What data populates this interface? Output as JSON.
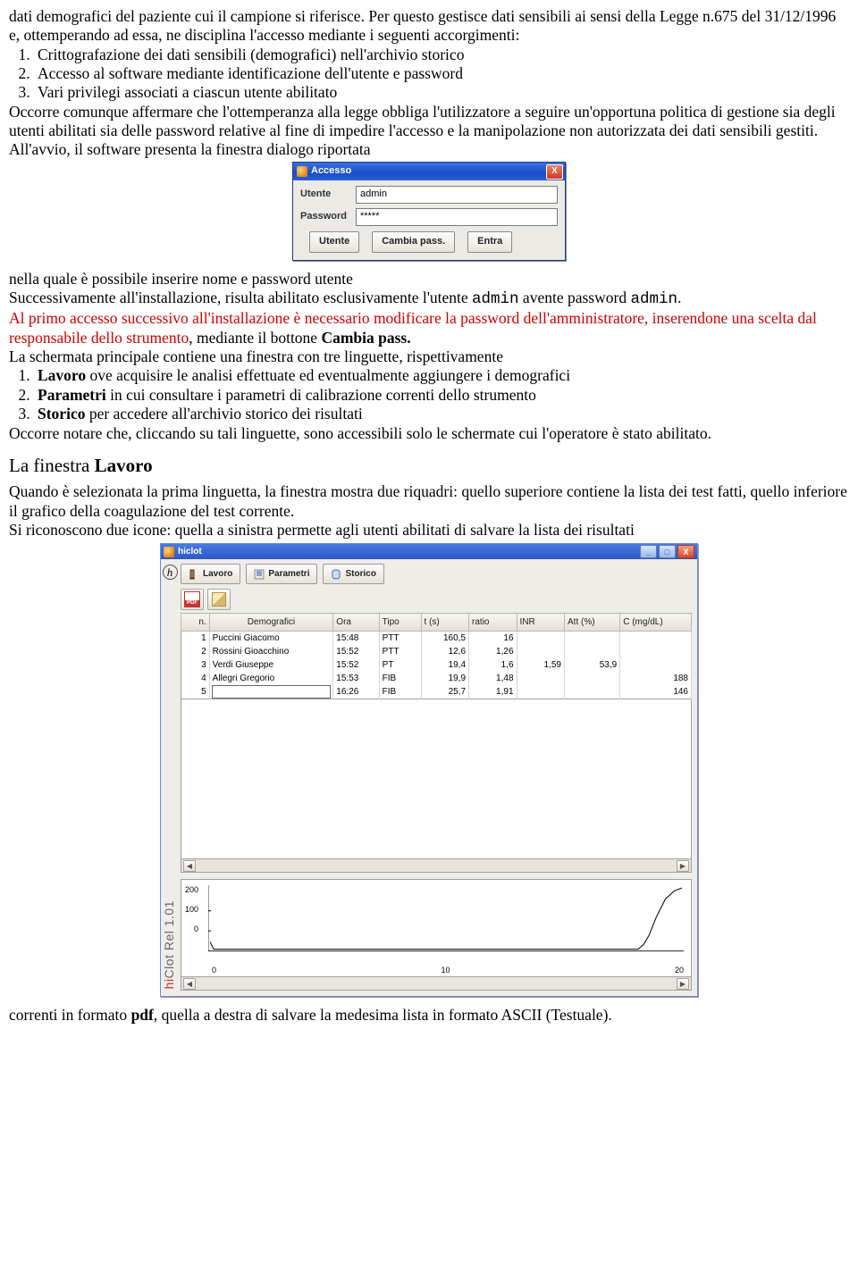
{
  "para1a": "dati demografici del paziente cui il campione si riferisce. Per questo gestisce dati sensibili ai sensi della Legge n.675 del 31/12/1996 e, ottemperando ad essa, ne disciplina l'accesso mediante i seguenti accorgimenti:",
  "list1": {
    "i1": "Crittografazione dei dati sensibili (demografici) nell'archivio storico",
    "i2": "Accesso al software mediante identificazione dell'utente e password",
    "i3": "Vari privilegi associati a ciascun utente abilitato"
  },
  "para1b": "Occorre comunque affermare che l'ottemperanza alla legge obbliga l'utilizzatore a seguire un'opportuna politica di gestione sia degli utenti abilitati sia delle password relative al fine di impedire l'accesso e la manipolazione non autorizzata dei dati sensibili gestiti.",
  "para1c": "All'avvio, il software presenta la finestra dialogo riportata",
  "accesso": {
    "title": "Accesso",
    "lblUser": "Utente",
    "lblPass": "Password",
    "valUser": "admin",
    "valPass": "*****",
    "btnUser": "Utente",
    "btnChange": "Cambia pass.",
    "btnEnter": "Entra"
  },
  "para2a": "nella quale è possibile inserire nome e password utente",
  "para2b_pre": "Successivamente all'installazione, risulta abilitato esclusivamente l'utente ",
  "para2b_code1": "admin",
  "para2b_mid": " avente password ",
  "para2b_code2": "admin",
  "para2b_post": ".",
  "para3_red": "Al primo accesso successivo all'installazione è necessario modificare la password dell'amministratore, inserendone una scelta dal responsabile dello strumento",
  "para3_tail1": ", mediante il bottone ",
  "para3_bold": "Cambia pass.",
  "para4": "La schermata principale contiene una finestra con tre linguette, rispettivamente",
  "list2": {
    "i1b": "Lavoro",
    "i1t": " ove acquisire le analisi effettuate ed eventualmente aggiungere i demografici",
    "i2b": "Parametri",
    "i2t": " in cui consultare i parametri di calibrazione correnti dello strumento",
    "i3b": "Storico",
    "i3t": " per accedere all'archivio storico dei risultati"
  },
  "para5": "Occorre notare che, cliccando su tali linguette, sono accessibili solo le schermate cui l'operatore è stato abilitato.",
  "section_h_pre": "La finestra ",
  "section_h_b": "Lavoro",
  "para6": "Quando è selezionata la prima linguetta, la finestra mostra due riquadri: quello superiore contiene la lista dei test fatti, quello inferiore il grafico della coagulazione del test corrente.",
  "para7": "Si riconoscono due icone: quella a sinistra permette agli utenti abilitati di salvare la lista dei risultati",
  "app": {
    "title": "hiclot",
    "vlabel_hi": "hi",
    "vlabel_rest": "Clot Rel 1.01",
    "tabs": {
      "t1": "Lavoro",
      "t2": "Parametri",
      "t3": "Storico"
    },
    "headers": {
      "n": "n.",
      "demo": "Demografici",
      "ora": "Ora",
      "tipo": "Tipo",
      "t": "t (s)",
      "ratio": "ratio",
      "inr": "INR",
      "att": "Att (%)",
      "c": "C (mg/dL)"
    },
    "rows": [
      {
        "n": "1",
        "demo": "Puccini Giacomo",
        "ora": "15:48",
        "tipo": "PTT",
        "t": "160,5",
        "ratio": "16",
        "inr": "",
        "att": "",
        "c": ""
      },
      {
        "n": "2",
        "demo": "Rossini Gioacchino",
        "ora": "15:52",
        "tipo": "PTT",
        "t": "12,6",
        "ratio": "1,26",
        "inr": "",
        "att": "",
        "c": ""
      },
      {
        "n": "3",
        "demo": "Verdi Giuseppe",
        "ora": "15:52",
        "tipo": "PT",
        "t": "19,4",
        "ratio": "1,6",
        "inr": "1,59",
        "att": "53,9",
        "c": ""
      },
      {
        "n": "4",
        "demo": "Allegri Gregorio",
        "ora": "15:53",
        "tipo": "FIB",
        "t": "19,9",
        "ratio": "1,48",
        "inr": "",
        "att": "",
        "c": "188"
      },
      {
        "n": "5",
        "demo": "",
        "ora": "16:26",
        "tipo": "FIB",
        "t": "25,7",
        "ratio": "1,91",
        "inr": "",
        "att": "",
        "c": "146"
      }
    ],
    "yticks": {
      "y200": "200",
      "y100": "100",
      "y0": "0"
    },
    "xticks": {
      "x0": "0",
      "x10": "10",
      "x20": "20"
    }
  },
  "para8_pre": "correnti in formato ",
  "para8_b": "pdf",
  "para8_post": ", quella a destra di salvare la medesima lista in formato ASCII (Testuale)."
}
